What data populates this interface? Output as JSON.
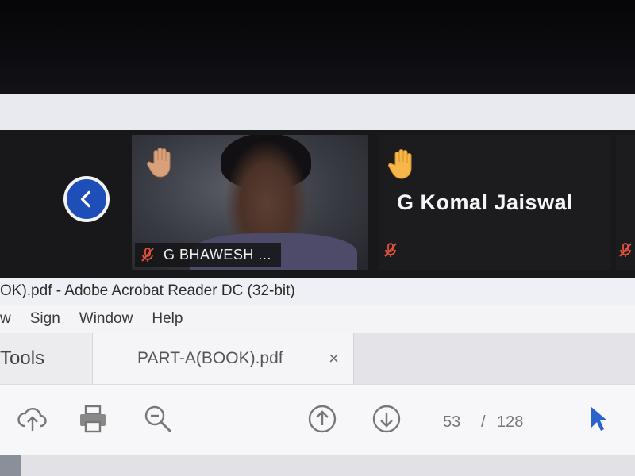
{
  "meeting": {
    "participants": [
      {
        "name": "G BHAWESH ...",
        "hand_raised": true,
        "muted": true,
        "video": true
      },
      {
        "name": "G Komal Jaiswal",
        "hand_raised": true,
        "muted": true,
        "video": false
      }
    ],
    "nav_icon": "chevron-left-icon",
    "colors": {
      "strip_bg": "#18181b",
      "nav_button": "#1e4fb8",
      "mic_off": "#e5533d",
      "hand": "#f6b64a"
    }
  },
  "acrobat": {
    "window_title": "OK).pdf - Adobe Acrobat Reader DC (32-bit)",
    "menu": [
      "w",
      "Sign",
      "Window",
      "Help"
    ],
    "tabs": {
      "tools_label": "Tools",
      "document_label": "PART-A(BOOK).pdf",
      "close_glyph": "×"
    },
    "toolbar": {
      "icons": [
        "upload-cloud-icon",
        "print-icon",
        "zoom-out-icon",
        "page-up-icon",
        "page-down-icon",
        "select-cursor-icon"
      ],
      "current_page": "53",
      "page_separator": "/",
      "total_pages": "128"
    }
  }
}
